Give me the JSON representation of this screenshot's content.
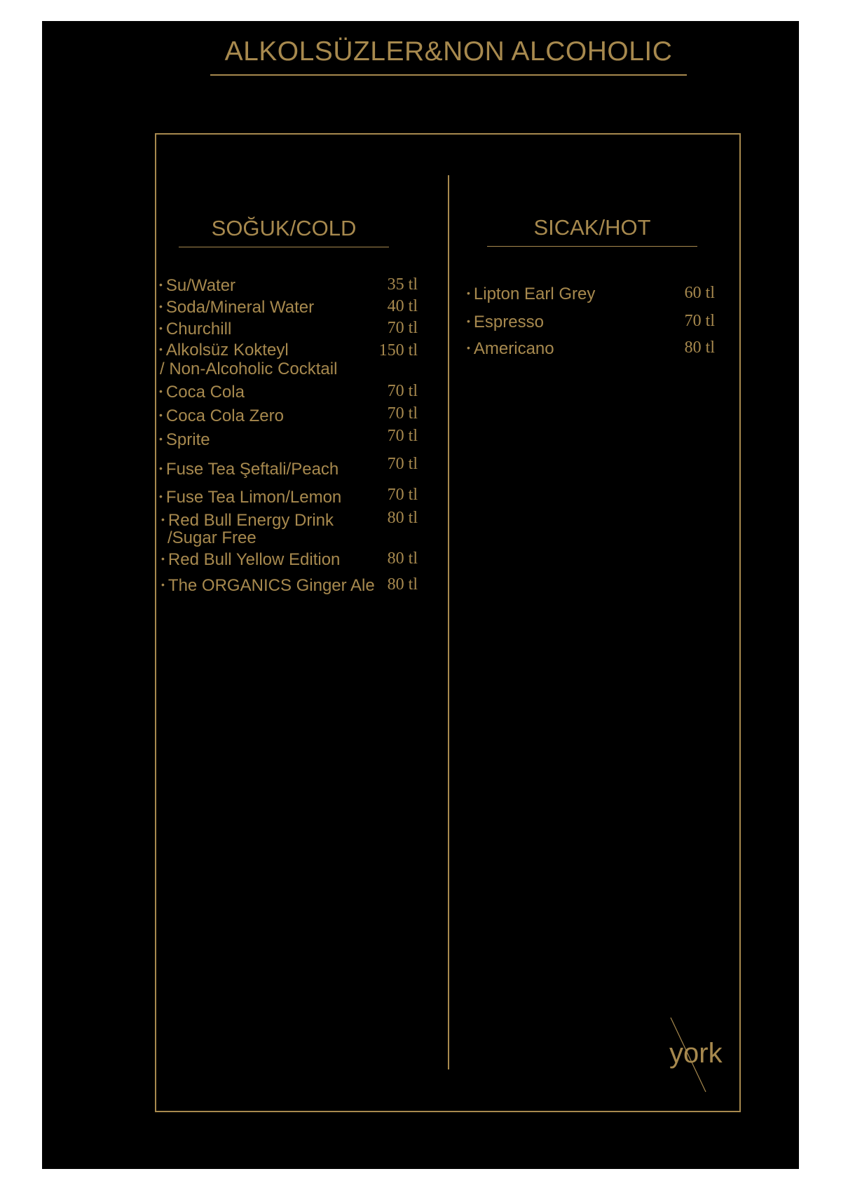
{
  "title": "ALKOLSÜZLER&NON ALCOHOLIC",
  "colors": {
    "background": "#000000",
    "accent": "#a7894e",
    "page": "#ffffff"
  },
  "cold": {
    "title": "SOĞUK/COLD",
    "items": [
      {
        "name": "Su/Water",
        "price": "35 tl"
      },
      {
        "name": "Soda/Mineral Water",
        "price": "40 tl"
      },
      {
        "name": "Churchill",
        "price": "70 tl"
      },
      {
        "name": "Alkolsüz Kokteyl",
        "name2": "/ Non-Alcoholic Cocktail",
        "price": "150 tl"
      },
      {
        "name": "Coca Cola",
        "price": "70 tl"
      },
      {
        "name": "Coca Cola Zero",
        "price": "70 tl"
      },
      {
        "name": "Sprite",
        "price": "70 tl"
      },
      {
        "name": "Fuse Tea Şeftali/Peach",
        "price": "70 tl"
      },
      {
        "name": "Fuse Tea Limon/Lemon",
        "price": "70 tl"
      },
      {
        "name": "Red Bull Energy Drink",
        "name2": "/Sugar Free",
        "price": "80 tl"
      },
      {
        "name": "Red Bull Yellow Edition",
        "price": "80 tl"
      },
      {
        "name": "The ORGANICS Ginger Ale",
        "price": "80 tl"
      }
    ]
  },
  "hot": {
    "title": "SICAK/HOT",
    "items": [
      {
        "name": "Lipton Earl Grey",
        "price": "60 tl"
      },
      {
        "name": "Espresso",
        "price": "70 tl"
      },
      {
        "name": "Americano",
        "price": "80 tl"
      }
    ]
  },
  "logo": {
    "text": "york"
  }
}
